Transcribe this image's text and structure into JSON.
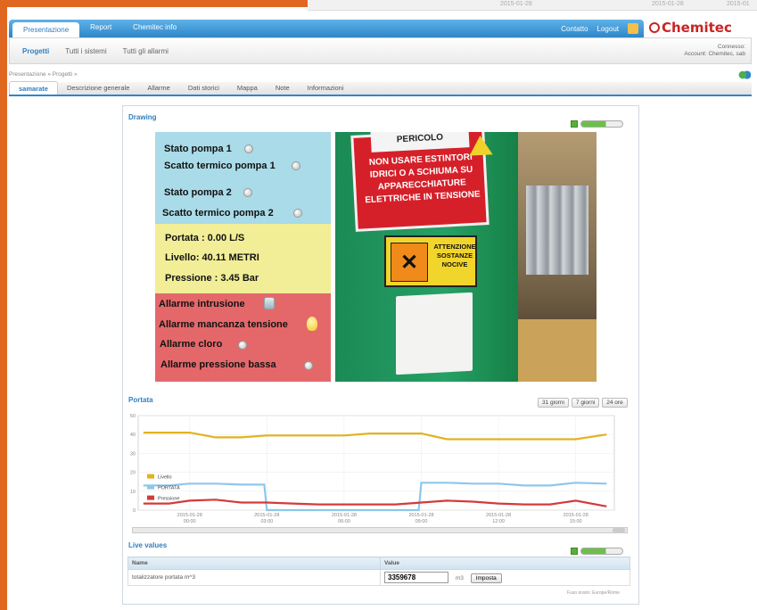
{
  "background_strip": {
    "date1": "2015-01-28",
    "date2": "2015-01-28",
    "date3": "2015-01"
  },
  "topnav": {
    "tabs": [
      {
        "label": "Presentazione",
        "active": true
      },
      {
        "label": "Report",
        "active": false
      },
      {
        "label": "Chemitec info",
        "active": false
      }
    ],
    "contatto": "Contatto",
    "logout": "Logout",
    "logo": "Chemitec"
  },
  "subnav": {
    "items": [
      {
        "label": "Progetti",
        "active": true
      },
      {
        "label": "Tutti i sistemi",
        "active": false
      },
      {
        "label": "Tutti gli allarmi",
        "active": false
      }
    ],
    "connected_label": "Connesso:",
    "account_label": "Account: Chemitec, sab"
  },
  "breadcrumb": "Presentazione » Progetti »",
  "page_tabs": [
    {
      "label": "samarate",
      "active": true
    },
    {
      "label": "Descrizione generale",
      "active": false
    },
    {
      "label": "Allarme",
      "active": false
    },
    {
      "label": "Dati storici",
      "active": false
    },
    {
      "label": "Mappa",
      "active": false
    },
    {
      "label": "Note",
      "active": false
    },
    {
      "label": "Informazioni",
      "active": false
    }
  ],
  "drawing": {
    "title": "Drawing",
    "status": [
      {
        "label": "Stato pompa 1"
      },
      {
        "label": "Scatto termico pompa 1"
      },
      {
        "label": "Stato pompa 2"
      },
      {
        "label": "Scatto termico pompa 2"
      }
    ],
    "measures": [
      {
        "label": "Portata : 0.00 L/S"
      },
      {
        "label": "Livello: 40.11 METRI"
      },
      {
        "label": "Pressione : 3.45 Bar"
      }
    ],
    "alarms": [
      {
        "label": "Allarme intrusione"
      },
      {
        "label": "Allarme mancanza tensione"
      },
      {
        "label": "Allarme cloro"
      },
      {
        "label": "Allarme pressione bassa"
      }
    ],
    "photo": {
      "sign_head": "PERICOLO",
      "sign_text": "NON USARE ESTINTORI IDRICI O A SCHIUMA SU APPARECCHIATURE ELETTRICHE IN TENSIONE",
      "warning_text": "ATTENZIONE SOSTANZE NOCIVE",
      "warning_symbol": "✕"
    }
  },
  "portata": {
    "title": "Portata",
    "range_buttons": [
      "31 giorni",
      "7 giorni",
      "24 ore"
    ]
  },
  "chart_data": {
    "type": "line",
    "title": "Portata",
    "ylim": [
      0,
      50
    ],
    "y_ticks": [
      "50",
      "40",
      "30",
      "20",
      "10",
      "0"
    ],
    "x_ticks": [
      {
        "date": "2015-01-28",
        "time": "00:00"
      },
      {
        "date": "2015-01-28",
        "time": "03:00"
      },
      {
        "date": "2015-01-28",
        "time": "06:00"
      },
      {
        "date": "2015-01-28",
        "time": "09:00"
      },
      {
        "date": "2015-01-28",
        "time": "12:00"
      },
      {
        "date": "2015-01-28",
        "time": "15:00"
      }
    ],
    "x_hours": [
      -2,
      16.5
    ],
    "legend_position": "bottom-left",
    "series": [
      {
        "name": "Livello",
        "color": "#e2b21e",
        "x": [
          -1.8,
          -0.8,
          0,
          1,
          2,
          3,
          4,
          5,
          6,
          7,
          8,
          9,
          10,
          11,
          12,
          13,
          14,
          15,
          16.2
        ],
        "y": [
          41,
          41,
          41,
          38.5,
          38.5,
          39.5,
          39.5,
          39.5,
          39.5,
          40.5,
          40.5,
          40.5,
          37.5,
          37.5,
          37.5,
          37.5,
          37.5,
          37.5,
          40
        ]
      },
      {
        "name": "PORTATA",
        "color": "#8fc7ea",
        "x": [
          -1.8,
          -0.8,
          0,
          1,
          2,
          2.9,
          3,
          4,
          5,
          6,
          7,
          8,
          8.9,
          9,
          10,
          11,
          12,
          13,
          14,
          15,
          16.2
        ],
        "y": [
          13,
          13,
          14,
          14,
          13.5,
          13.5,
          0,
          0,
          0,
          0,
          0,
          0,
          0,
          14.5,
          14.5,
          14,
          14,
          13,
          13,
          14.5,
          14
        ]
      },
      {
        "name": "Pressione",
        "color": "#d43a3a",
        "x": [
          -1.8,
          -0.8,
          0,
          1,
          2,
          3,
          4,
          5,
          6,
          7,
          8,
          9,
          10,
          11,
          12,
          13,
          14,
          15,
          16.2
        ],
        "y": [
          3.5,
          3.5,
          5,
          5.5,
          4,
          4,
          3.5,
          3,
          3,
          3,
          3,
          4,
          5,
          4.5,
          3.5,
          3,
          3,
          5,
          2
        ]
      }
    ]
  },
  "live_values": {
    "title": "Live values",
    "col_name": "Name",
    "col_value": "Value",
    "row_name": "totalizzatore portata m^3",
    "row_value": "3359678",
    "row_unit": "m3",
    "button": "Imposta"
  },
  "footnote": "Fuso orario: Europe/Rome",
  "colors": {
    "accent": "#2f86c9",
    "brand_red": "#c92424",
    "orange": "#e0671f"
  }
}
